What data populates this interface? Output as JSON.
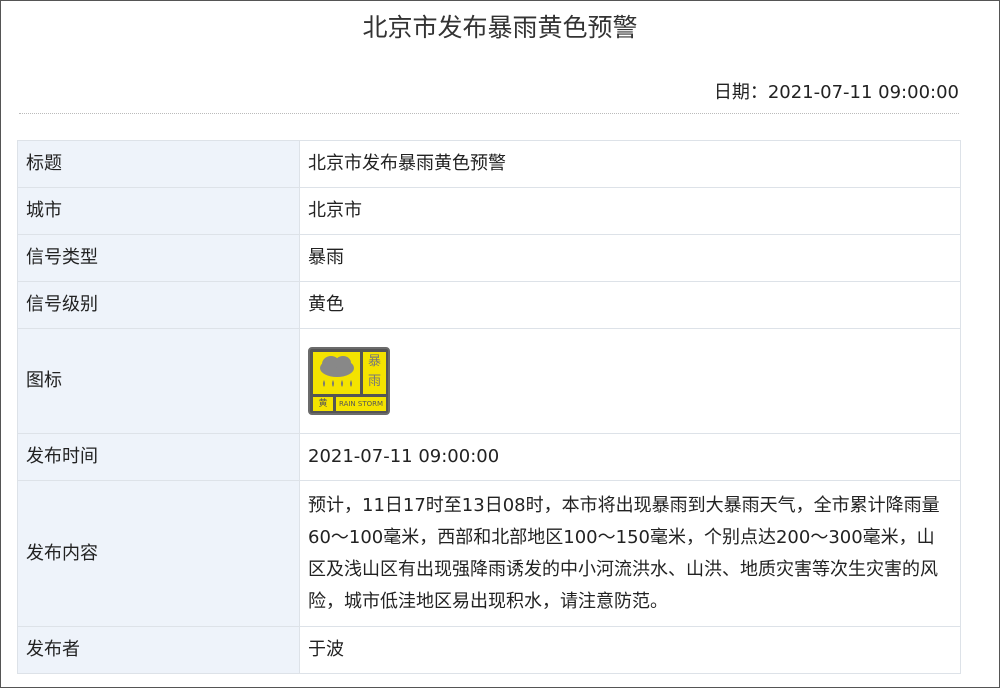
{
  "page": {
    "title": "北京市发布暴雨黄色预警",
    "date_line": "日期：2021-07-11 09:00:00"
  },
  "rows": [
    {
      "label": "标题",
      "value": "北京市发布暴雨黄色预警"
    },
    {
      "label": "城市",
      "value": "北京市"
    },
    {
      "label": "信号类型",
      "value": "暴雨"
    },
    {
      "label": "信号级别",
      "value": "黄色"
    },
    {
      "label": "图标",
      "value": ""
    },
    {
      "label": "发布时间",
      "value": "2021-07-11 09:00:00"
    },
    {
      "label": "发布内容",
      "value": "预计，11日17时至13日08时，本市将出现暴雨到大暴雨天气，全市累计降雨量60～100毫米，西部和北部地区100～150毫米，个别点达200～300毫米，山区及浅山区有出现强降雨诱发的中小河流洪水、山洪、地质灾害等次生灾害的风险，城市低洼地区易出现积水，请注意防范。"
    },
    {
      "label": "发布者",
      "value": "于波"
    }
  ],
  "icon": {
    "name": "rainstorm-yellow-warning-icon",
    "char_top": "暴",
    "char_bottom": "雨",
    "text_left": "黄",
    "text_right": "RAIN STORM",
    "colors": {
      "fill": "#f4e300",
      "border": "#555555"
    }
  }
}
